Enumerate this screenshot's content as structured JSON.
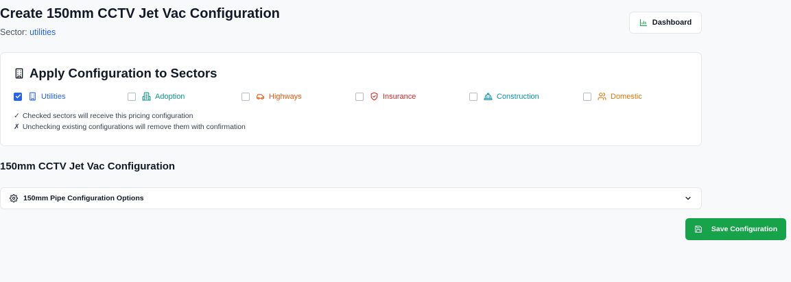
{
  "header": {
    "title": "Create 150mm CCTV Jet Vac Configuration",
    "sector_label": "Sector:",
    "sector_value": "utilities",
    "dashboard_label": "Dashboard"
  },
  "sectors_card": {
    "title": "Apply Configuration to Sectors",
    "sectors": [
      {
        "label": "Utilities",
        "checked": true,
        "color": "#2563eb",
        "icon": "building-icon"
      },
      {
        "label": "Adoption",
        "checked": false,
        "color": "#0d9488",
        "icon": "building-2-icon"
      },
      {
        "label": "Highways",
        "checked": false,
        "color": "#ea580c",
        "icon": "car-icon"
      },
      {
        "label": "Insurance",
        "checked": false,
        "color": "#dc2626",
        "icon": "shield-icon"
      },
      {
        "label": "Construction",
        "checked": false,
        "color": "#0891b2",
        "icon": "hard-hat-icon"
      },
      {
        "label": "Domestic",
        "checked": false,
        "color": "#d97706",
        "icon": "users-icon"
      }
    ],
    "notes": [
      {
        "symbol": "✓",
        "text": "Checked sectors will receive this pricing configuration"
      },
      {
        "symbol": "✗",
        "text": "Unchecking existing configurations will remove them with confirmation"
      }
    ]
  },
  "config_section": {
    "title": "150mm CCTV Jet Vac Configuration",
    "accordion_label": "150mm Pipe Configuration Options"
  },
  "actions": {
    "save_label": "Save Configuration"
  }
}
